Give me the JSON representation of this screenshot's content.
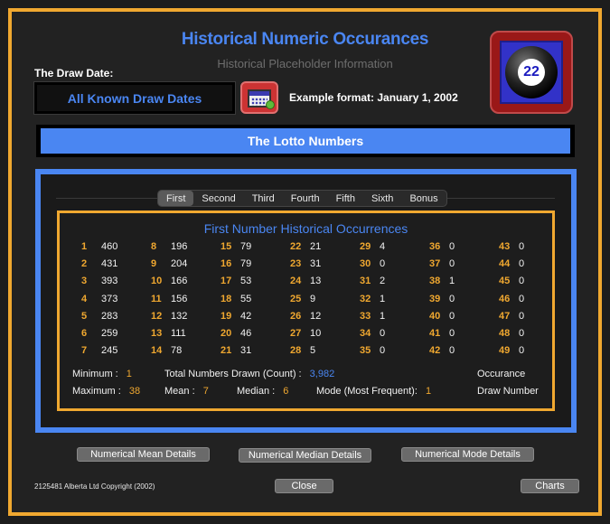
{
  "header": {
    "title": "Historical Numeric Occurances",
    "subtitle": "Historical Placeholder Information"
  },
  "draw_date": {
    "label": "The Draw Date:",
    "value": "All Known Draw Dates",
    "example": "Example format: January 1, 2002"
  },
  "logo": {
    "ball_number": "22"
  },
  "lotto_bar": {
    "label": "The Lotto Numbers"
  },
  "tabs": [
    "First",
    "Second",
    "Third",
    "Fourth",
    "Fifth",
    "Sixth",
    "Bonus"
  ],
  "active_tab": "First",
  "occurrences": {
    "title": "First Number Historical Occurrences",
    "columns": [
      [
        [
          "1",
          "460"
        ],
        [
          "2",
          "431"
        ],
        [
          "3",
          "393"
        ],
        [
          "4",
          "373"
        ],
        [
          "5",
          "283"
        ],
        [
          "6",
          "259"
        ],
        [
          "7",
          "245"
        ]
      ],
      [
        [
          "8",
          "196"
        ],
        [
          "9",
          "204"
        ],
        [
          "10",
          "166"
        ],
        [
          "11",
          "156"
        ],
        [
          "12",
          "132"
        ],
        [
          "13",
          "111"
        ],
        [
          "14",
          "78"
        ]
      ],
      [
        [
          "15",
          "79"
        ],
        [
          "16",
          "79"
        ],
        [
          "17",
          "53"
        ],
        [
          "18",
          "55"
        ],
        [
          "19",
          "42"
        ],
        [
          "20",
          "46"
        ],
        [
          "21",
          "31"
        ]
      ],
      [
        [
          "22",
          "21"
        ],
        [
          "23",
          "31"
        ],
        [
          "24",
          "13"
        ],
        [
          "25",
          "9"
        ],
        [
          "26",
          "12"
        ],
        [
          "27",
          "10"
        ],
        [
          "28",
          "5"
        ]
      ],
      [
        [
          "29",
          "4"
        ],
        [
          "30",
          "0"
        ],
        [
          "31",
          "2"
        ],
        [
          "32",
          "1"
        ],
        [
          "33",
          "1"
        ],
        [
          "34",
          "0"
        ],
        [
          "35",
          "0"
        ]
      ],
      [
        [
          "36",
          "0"
        ],
        [
          "37",
          "0"
        ],
        [
          "38",
          "1"
        ],
        [
          "39",
          "0"
        ],
        [
          "40",
          "0"
        ],
        [
          "41",
          "0"
        ],
        [
          "42",
          "0"
        ]
      ],
      [
        [
          "43",
          "0"
        ],
        [
          "44",
          "0"
        ],
        [
          "45",
          "0"
        ],
        [
          "46",
          "0"
        ],
        [
          "47",
          "0"
        ],
        [
          "48",
          "0"
        ],
        [
          "49",
          "0"
        ]
      ]
    ]
  },
  "stats": {
    "minimum_label": "Minimum :",
    "minimum": "1",
    "maximum_label": "Maximum :",
    "maximum": "38",
    "total_label": "Total Numbers Drawn (Count) :",
    "total": "3,982",
    "mean_label": "Mean :",
    "mean": "7",
    "median_label": "Median :",
    "median": "6",
    "mode_label": "Mode (Most Frequent):",
    "mode": "1",
    "legend_occurance": "Occurance",
    "legend_draw_number": "Draw Number"
  },
  "buttons": {
    "mean_details": "Numerical Mean Details",
    "median_details": "Numerical Median Details",
    "mode_details": "Numerical Mode Details",
    "close": "Close",
    "charts": "Charts"
  },
  "footer": {
    "copyright": "2125481 Alberta Ltd Copyright (2002)"
  },
  "colors": {
    "accent_blue": "#4a86f2",
    "accent_orange": "#f0a830",
    "background": "#222222"
  }
}
